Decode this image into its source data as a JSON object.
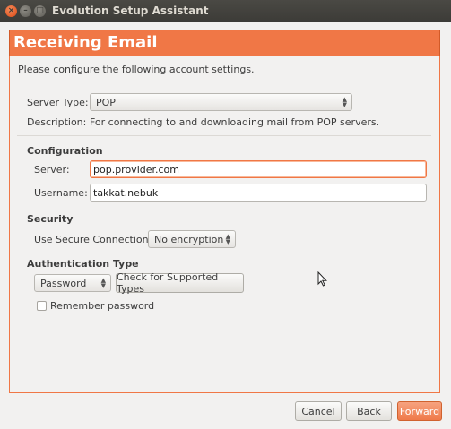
{
  "window": {
    "title": "Evolution Setup Assistant",
    "close_glyph": "×",
    "min_glyph": "–",
    "max_glyph": "□"
  },
  "header": {
    "title": "Receiving Email",
    "accent": "#f07746"
  },
  "intro": "Please configure the following account settings.",
  "server_type": {
    "label": "Server Type:",
    "value": "POP",
    "description_label": "Description:",
    "description": "For connecting to and downloading mail from POP servers."
  },
  "configuration": {
    "heading": "Configuration",
    "server_label": "Server:",
    "server_value": "pop.provider.com",
    "username_label": "Username:",
    "username_value": "takkat.nebuk"
  },
  "security": {
    "heading": "Security",
    "secure_label": "Use Secure Connection:",
    "secure_value": "No encryption"
  },
  "authentication": {
    "heading": "Authentication Type",
    "type_value": "Password",
    "check_button": "Check for Supported Types",
    "remember_label": "Remember password"
  },
  "footer": {
    "cancel": "Cancel",
    "back": "Back",
    "forward": "Forward"
  }
}
